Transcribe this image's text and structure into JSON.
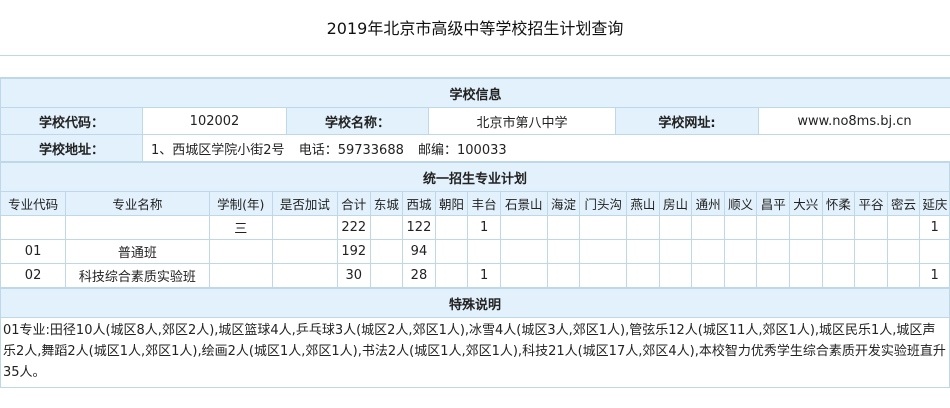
{
  "page_title": "2019年北京市高级中等学校招生计划查询",
  "school_info": {
    "section_title": "学校信息",
    "code_label": "学校代码：",
    "code": "102002",
    "name_label": "学校名称：",
    "name": "北京市第八中学",
    "site_label": "学校网址:",
    "site": "www.no8ms.bj.cn",
    "addr_label": "学校地址：",
    "address": "1、西城区学院小街2号",
    "phone": "电话：59733688",
    "postcode": "邮编：100033"
  },
  "plan": {
    "section_title": "统一招生专业计划",
    "headers": [
      "专业代码",
      "专业名称",
      "学制(年)",
      "是否加试",
      "合计",
      "东城",
      "西城",
      "朝阳",
      "丰台",
      "石景山",
      "海淀",
      "门头沟",
      "燕山",
      "房山",
      "通州",
      "顺义",
      "昌平",
      "大兴",
      "怀柔",
      "平谷",
      "密云",
      "延庆"
    ],
    "rows": [
      [
        "",
        "",
        "三",
        "",
        "222",
        "",
        "122",
        "",
        "1",
        "",
        "",
        "",
        "",
        "",
        "",
        "",
        "",
        "",
        "",
        "",
        "",
        "1"
      ],
      [
        "01",
        "普通班",
        "",
        "",
        "192",
        "",
        "94",
        "",
        "",
        "",
        "",
        "",
        "",
        "",
        "",
        "",
        "",
        "",
        "",
        "",
        "",
        ""
      ],
      [
        "02",
        "科技综合素质实验班",
        "",
        "",
        "30",
        "",
        "28",
        "",
        "1",
        "",
        "",
        "",
        "",
        "",
        "",
        "",
        "",
        "",
        "",
        "",
        "",
        "1"
      ]
    ]
  },
  "special": {
    "section_title": "特殊说明",
    "text": "01专业:田径10人(城区8人,郊区2人),城区篮球4人,乒乓球3人(城区2人,郊区1人),冰雪4人(城区3人,郊区1人),管弦乐12人(城区11人,郊区1人),城区民乐1人,城区声乐2人,舞蹈2人(城区1人,郊区1人),绘画2人(城区1人,郊区1人),书法2人(城区1人,郊区1人),科技21人(城区17人,郊区4人),本校智力优秀学生综合素质开发实验班直升35人。"
  }
}
